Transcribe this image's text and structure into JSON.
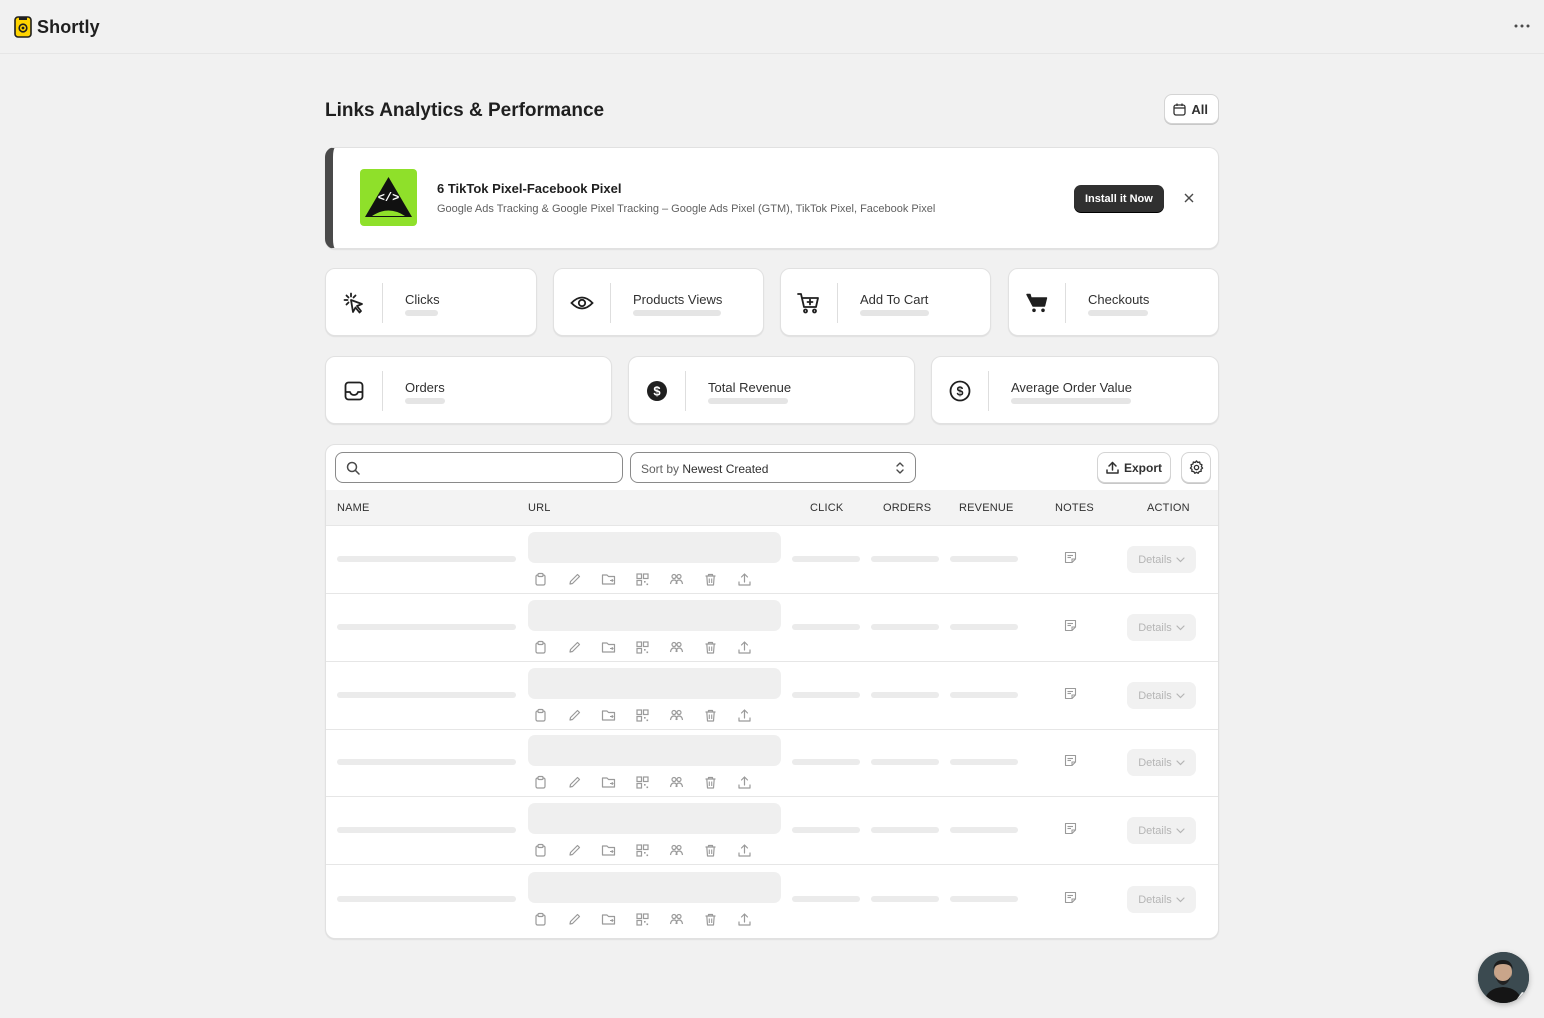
{
  "app": {
    "name": "Shortly"
  },
  "page": {
    "title": "Links Analytics & Performance",
    "date_filter": "All"
  },
  "banner": {
    "title": "6 TikTok Pixel-Facebook Pixel",
    "description": "Google Ads Tracking & Google Pixel Tracking – Google Ads Pixel (GTM), TikTok Pixel, Facebook Pixel",
    "cta": "Install it Now",
    "logo_color": "#8fe02a"
  },
  "stats": [
    {
      "label": "Clicks",
      "icon": "cursor-click-icon"
    },
    {
      "label": "Products Views",
      "icon": "eye-icon"
    },
    {
      "label": "Add To Cart",
      "icon": "cart-add-icon"
    },
    {
      "label": "Checkouts",
      "icon": "cart-filled-icon"
    },
    {
      "label": "Orders",
      "icon": "inbox-icon"
    },
    {
      "label": "Total Revenue",
      "icon": "dollar-filled-icon"
    },
    {
      "label": "Average Order Value",
      "icon": "dollar-outline-icon"
    }
  ],
  "toolbar": {
    "search_placeholder": "",
    "sort_prefix": "Sort by",
    "sort_value": "Newest Created",
    "export_label": "Export"
  },
  "table": {
    "columns": [
      "NAME",
      "URL",
      "CLICK",
      "ORDERS",
      "REVENUE",
      "NOTES",
      "ACTION"
    ],
    "details_label": "Details",
    "row_icons": [
      "copy-icon",
      "edit-icon",
      "folder-move-icon",
      "qr-code-icon",
      "group-icon",
      "trash-icon",
      "share-icon"
    ]
  },
  "colors": {
    "background": "#f1f1f1",
    "primary_button": "#303030",
    "accent_green": "#8fe02a",
    "brand_yellow": "#ffd400"
  }
}
